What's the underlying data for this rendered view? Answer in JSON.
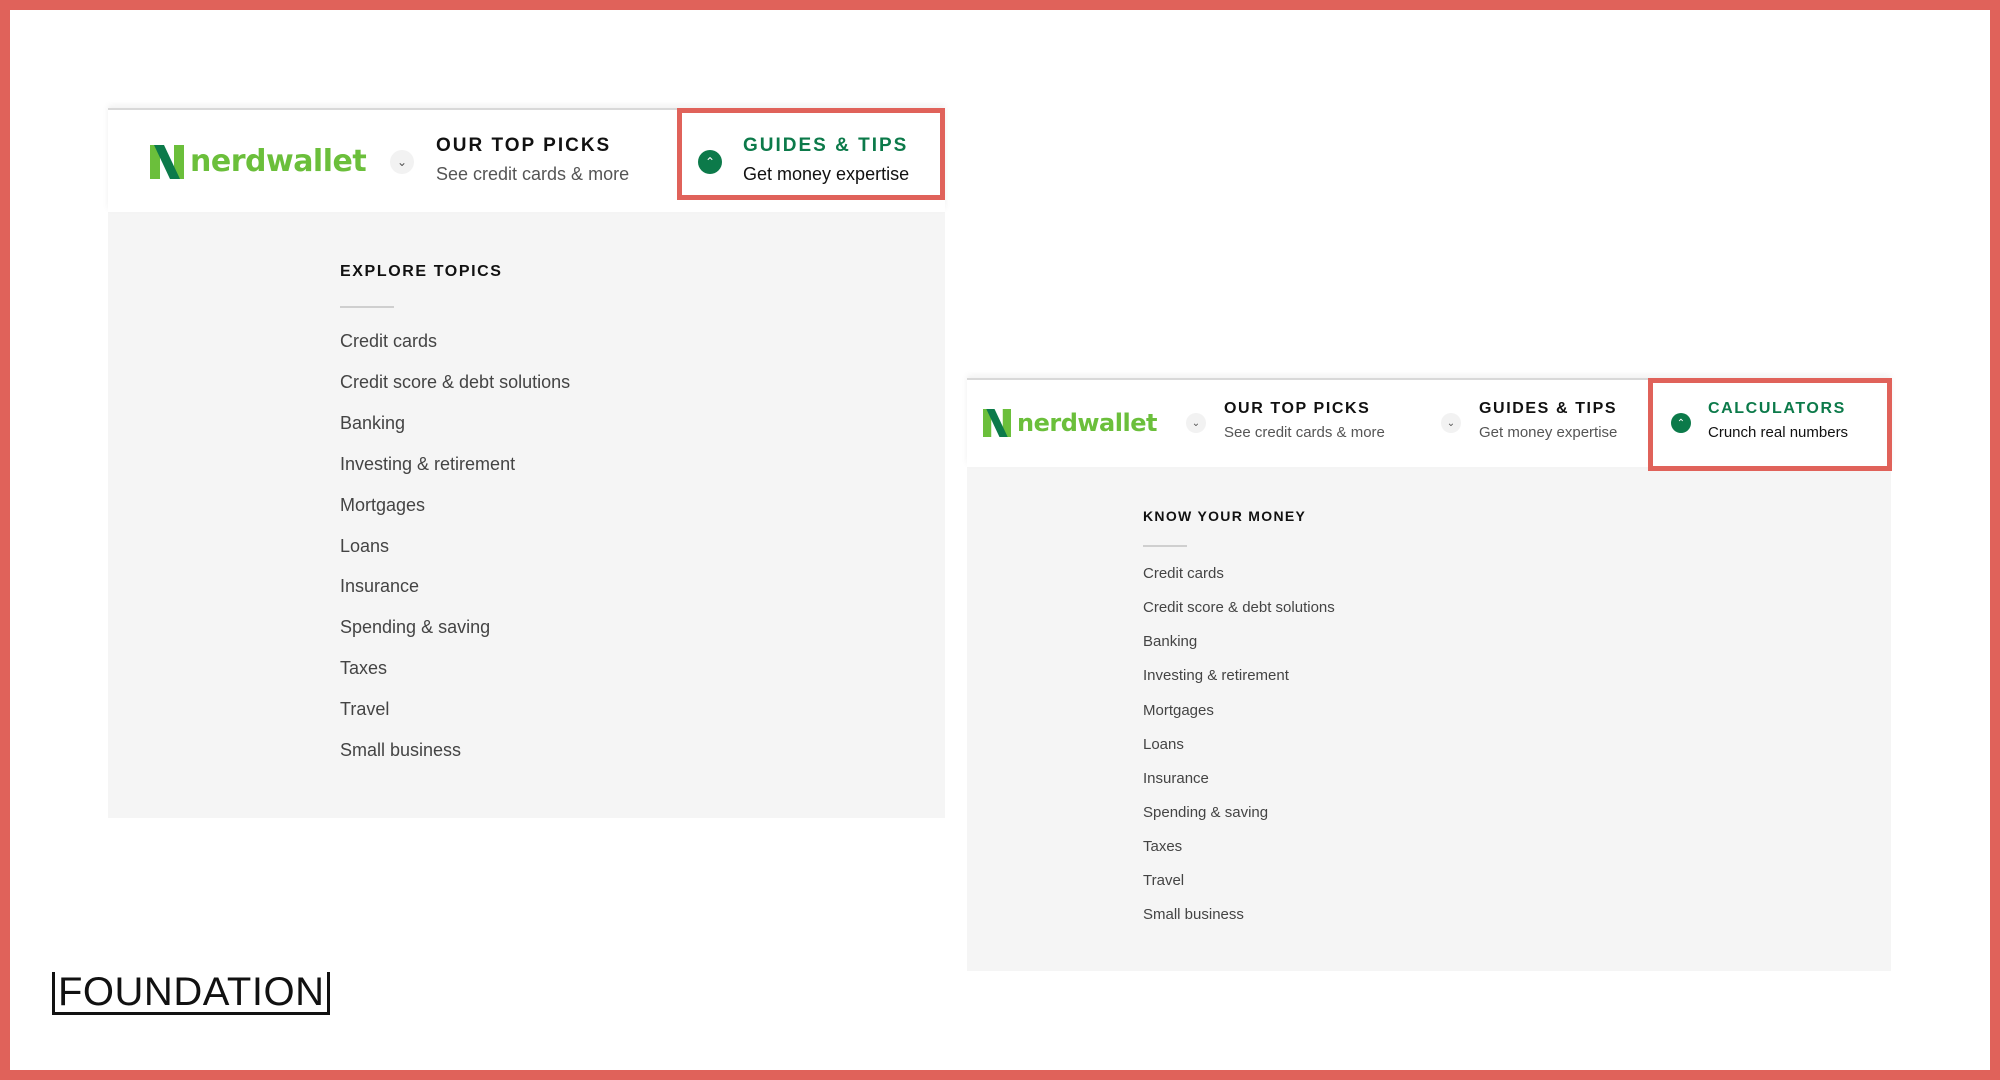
{
  "brand": {
    "logo_text": "nerdwallet",
    "logo_color": "#6bbf3b",
    "accent": "#0c7a4a",
    "highlight_color": "#e0625a"
  },
  "left_panel": {
    "nav": [
      {
        "title": "OUR TOP PICKS",
        "subtitle": "See credit cards & more",
        "icon": "chevron-down-icon",
        "active": false
      },
      {
        "title": "GUIDES & TIPS",
        "subtitle": "Get money expertise",
        "icon": "chevron-up-icon",
        "active": true
      }
    ],
    "menu": {
      "heading": "EXPLORE TOPICS",
      "links": [
        "Credit cards",
        "Credit score & debt solutions",
        "Banking",
        "Investing & retirement",
        "Mortgages",
        "Loans",
        "Insurance",
        "Spending & saving",
        "Taxes",
        "Travel",
        "Small business"
      ]
    }
  },
  "right_panel": {
    "nav": [
      {
        "title": "OUR TOP PICKS",
        "subtitle": "See credit cards & more",
        "icon": "chevron-down-icon",
        "active": false
      },
      {
        "title": "GUIDES & TIPS",
        "subtitle": "Get money expertise",
        "icon": "chevron-down-icon",
        "active": false
      },
      {
        "title": "CALCULATORS",
        "subtitle": "Crunch real numbers",
        "icon": "chevron-up-icon",
        "active": true
      }
    ],
    "menu": {
      "heading": "KNOW YOUR MONEY",
      "links": [
        "Credit cards",
        "Credit score & debt solutions",
        "Banking",
        "Investing & retirement",
        "Mortgages",
        "Loans",
        "Insurance",
        "Spending & saving",
        "Taxes",
        "Travel",
        "Small business"
      ]
    }
  },
  "footer": {
    "brand_text": "FOUNDATION"
  }
}
